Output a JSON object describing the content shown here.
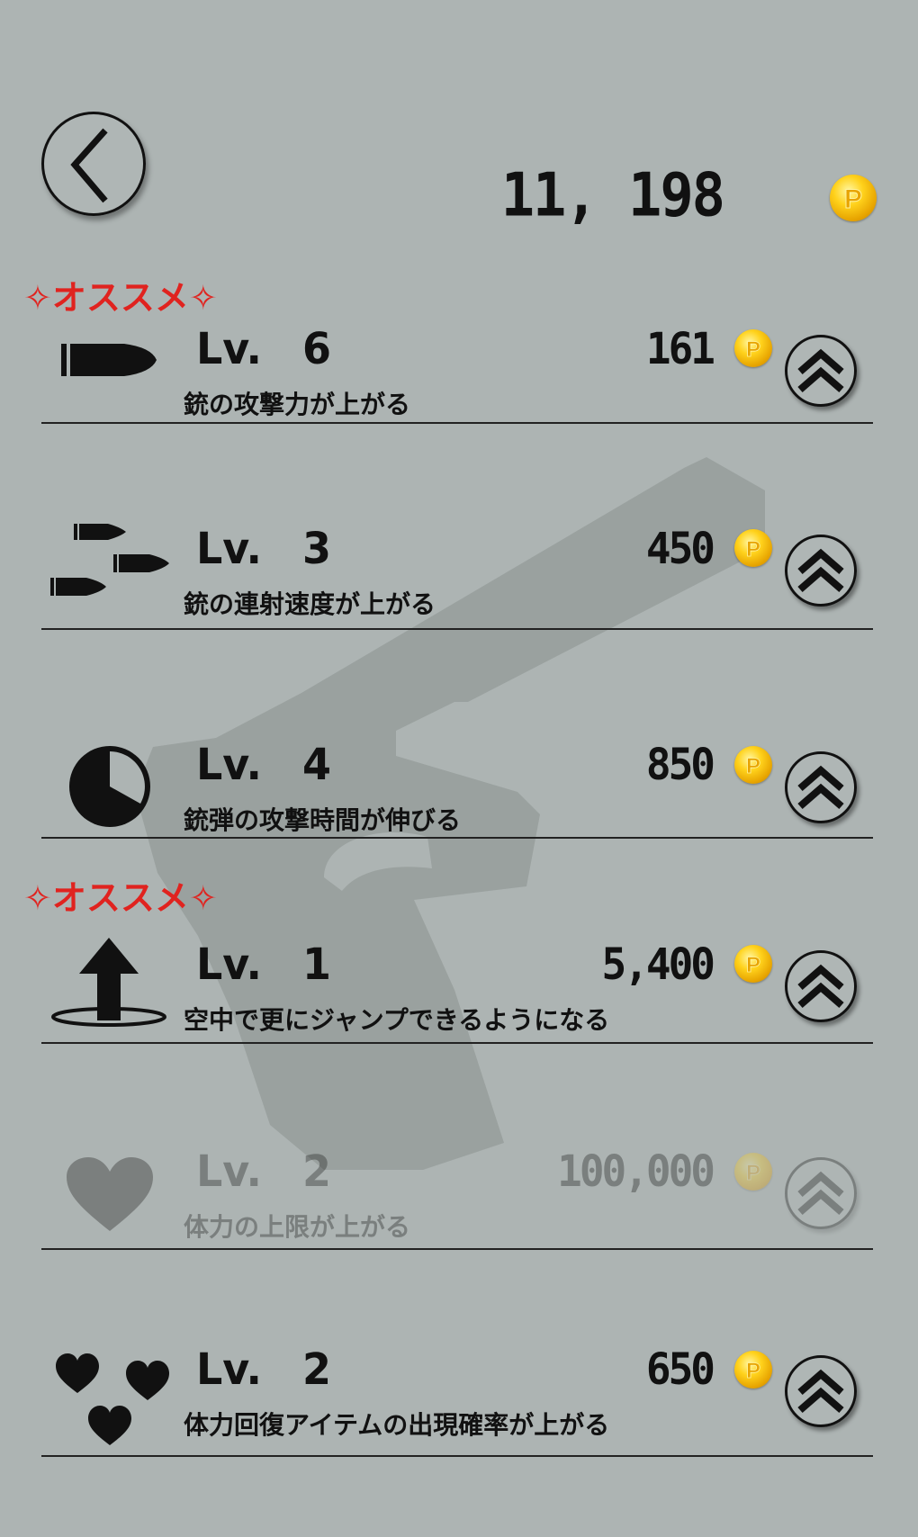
{
  "header": {
    "back_icon": "chevron-left-icon",
    "coin_total": "11, 198",
    "coin_icon": "p-coin-icon"
  },
  "recommend_label": "✧オススメ✧",
  "upgrades": [
    {
      "icon": "bullet-icon",
      "level_prefix": "Lv.",
      "level": "6",
      "price": "161",
      "description": "銃の攻撃力が上がる",
      "recommended": true,
      "enabled": true
    },
    {
      "icon": "bullets-icon",
      "level_prefix": "Lv.",
      "level": "3",
      "price": "450",
      "description": "銃の連射速度が上がる",
      "recommended": false,
      "enabled": true
    },
    {
      "icon": "timer-pie-icon",
      "level_prefix": "Lv.",
      "level": "4",
      "price": "850",
      "description": "銃弾の攻撃時間が伸びる",
      "recommended": false,
      "enabled": true
    },
    {
      "icon": "jump-arrow-icon",
      "level_prefix": "Lv.",
      "level": "1",
      "price": "5,400",
      "description": "空中で更にジャンプできるようになる",
      "recommended": true,
      "enabled": true
    },
    {
      "icon": "heart-icon",
      "level_prefix": "Lv.",
      "level": "2",
      "price": "100,000",
      "description": "体力の上限が上がる",
      "recommended": false,
      "enabled": false
    },
    {
      "icon": "hearts-icon",
      "level_prefix": "Lv.",
      "level": "2",
      "price": "650",
      "description": "体力回復アイテムの出現確率が上がる",
      "recommended": false,
      "enabled": true
    }
  ],
  "colors": {
    "background": "#adb4b3",
    "recommend": "#e0231f",
    "coin": "#ffd21c"
  }
}
